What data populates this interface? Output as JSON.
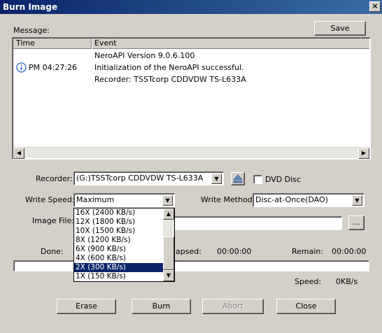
{
  "window": {
    "title": "Burn Image",
    "close_glyph": "×"
  },
  "message": {
    "label": "Message:",
    "save_label": "Save",
    "columns": {
      "time": "Time",
      "event": "Event"
    },
    "rows": [
      {
        "time": "",
        "event": "NeroAPI Version 9.0.6.100"
      },
      {
        "time": "PM 04:27:26",
        "event": "Initialization of the NeroAPI successful."
      },
      {
        "time": "",
        "event": "Recorder: TSSTcorp CDDVDW TS-L633A"
      }
    ],
    "info_icon": "info-icon"
  },
  "recorder": {
    "label": "Recorder:",
    "value": "(G:)TSSTcorp CDDVDW TS-L633A",
    "dvd_disc_label": "DVD Disc"
  },
  "write_speed": {
    "label": "Write Speed:",
    "value": "Maximum",
    "options": [
      "16X (2400 KB/s)",
      "12X (1800 KB/s)",
      "10X (1500 KB/s)",
      "8X (1200 KB/s)",
      "6X (900 KB/s)",
      "4X (600 KB/s)",
      "2X (300 KB/s)",
      "1X (150 KB/s)"
    ],
    "selected_option": "2X (300 KB/s)"
  },
  "write_method": {
    "label": "Write Method:",
    "value": "Disc-at-Once(DAO)"
  },
  "image_file": {
    "label": "Image File:",
    "value": "",
    "browse_label": "..."
  },
  "status": {
    "done_label": "Done:",
    "elapsed_label": "Elapsed:",
    "elapsed_value": "00:00:00",
    "remain_label": "Remain:",
    "remain_value": "00:00:00",
    "speed_label": "Speed:",
    "speed_value": "0KB/s",
    "progress": 0
  },
  "buttons": {
    "erase": "Erase",
    "burn": "Burn",
    "abort": "Abort",
    "close": "Close"
  }
}
